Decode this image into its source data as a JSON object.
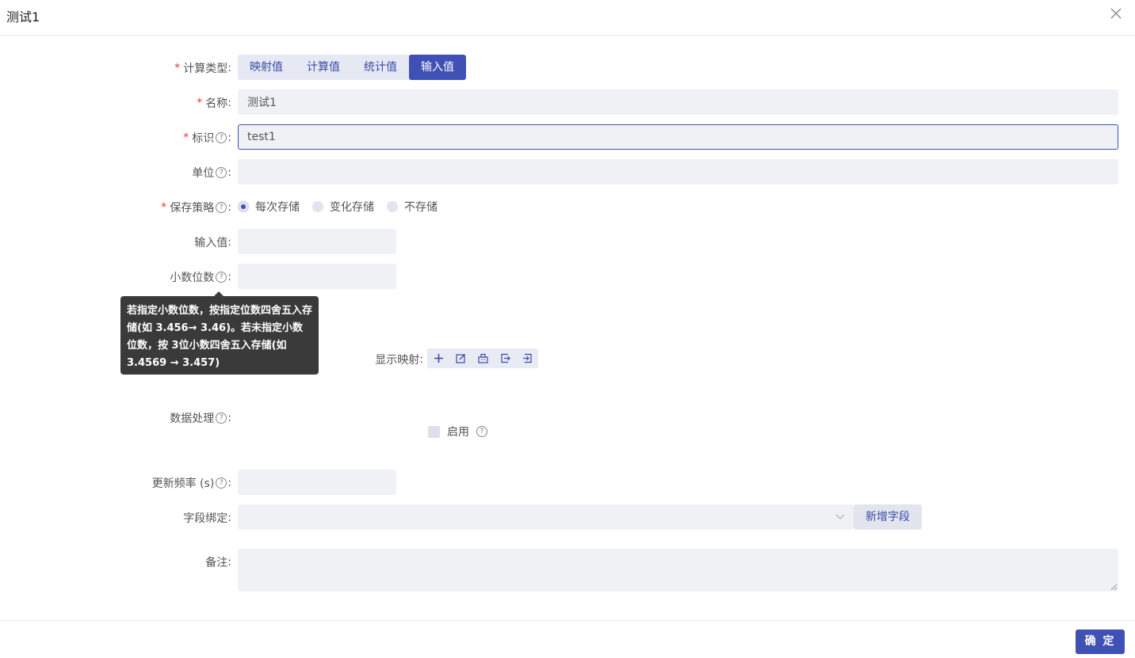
{
  "dialog": {
    "title": "测试1"
  },
  "form": {
    "calc_type": {
      "label": "计算类型",
      "options": [
        "映射值",
        "计算值",
        "统计值",
        "输入值"
      ],
      "selected": "输入值"
    },
    "name": {
      "label": "名称",
      "value": "测试1"
    },
    "ident": {
      "label": "标识",
      "value": "test1"
    },
    "unit": {
      "label": "单位",
      "value": ""
    },
    "save_policy": {
      "label": "保存策略",
      "options": [
        "每次存储",
        "变化存储",
        "不存储"
      ],
      "selected": "每次存储"
    },
    "input_value": {
      "label": "输入值",
      "value": ""
    },
    "decimals": {
      "label": "小数位数",
      "value": ""
    },
    "tooltip": {
      "text": "若指定小数位数，按指定位数四舍五入存储(如 3.456→ 3.46)。若未指定小数位数，按 3位小数四舍五入存储(如 3.4569 → 3.457)"
    },
    "display_mapping": {
      "label": "显示映射",
      "tools": [
        "plus-icon",
        "edit-icon",
        "building-icon",
        "export-icon",
        "import-icon"
      ]
    },
    "data_processing": {
      "label": "数据处理",
      "enable_label": "启用",
      "enabled": false
    },
    "update_freq": {
      "label": "更新频率 (s)",
      "value": ""
    },
    "field_binding": {
      "label": "字段绑定",
      "value": "",
      "add_button": "新增字段"
    },
    "remark": {
      "label": "备注",
      "value": ""
    }
  },
  "footer": {
    "confirm_label": "确 定"
  },
  "colors": {
    "primary": "#3f51b5",
    "required": "#e23c3c",
    "input_bg": "#f0f1f5"
  }
}
